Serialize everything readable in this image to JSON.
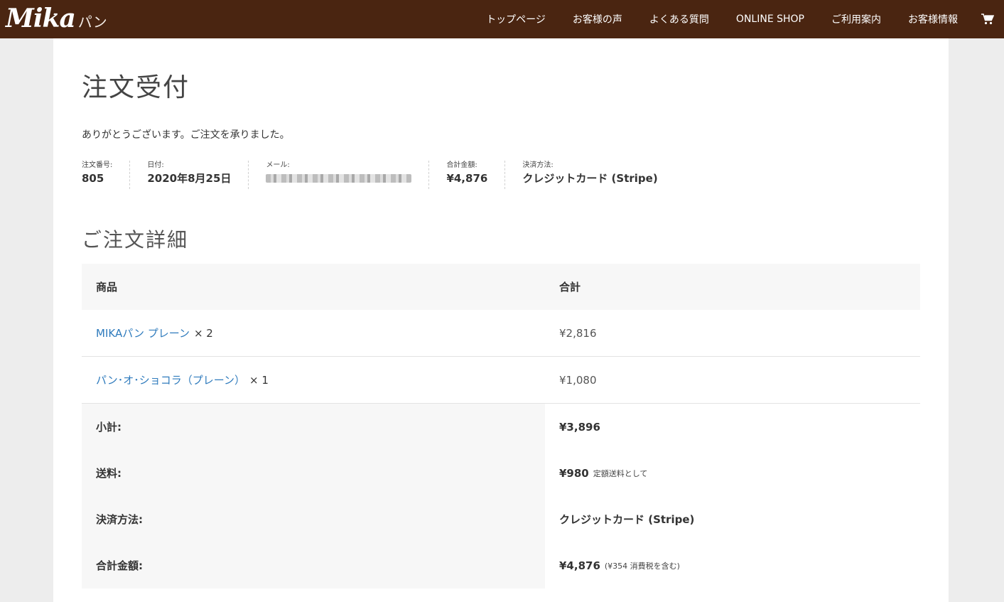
{
  "header": {
    "logo_main": "Mika",
    "logo_sub": "パン",
    "nav": [
      "トップページ",
      "お客様の声",
      "よくある質問",
      "ONLINE SHOP",
      "ご利用案内",
      "お客様情報"
    ]
  },
  "page": {
    "title": "注文受付",
    "thanks": "ありがとうございます。ご注文を承りました。"
  },
  "overview": {
    "order_number": {
      "label": "注文番号:",
      "value": "805"
    },
    "date": {
      "label": "日付:",
      "value": "2020年8月25日"
    },
    "email": {
      "label": "メール:"
    },
    "total": {
      "label": "合計金額:",
      "value": "¥4,876"
    },
    "payment": {
      "label": "決済方法:",
      "value": "クレジットカード (Stripe)"
    }
  },
  "details": {
    "title": "ご注文詳細",
    "headers": {
      "product": "商品",
      "total": "合計"
    },
    "items": [
      {
        "name": "MIKAパン プレーン",
        "qty": "× 2",
        "total": "¥2,816"
      },
      {
        "name": "パン･オ･ショコラ（プレーン）",
        "qty": "× 1",
        "total": "¥1,080"
      }
    ],
    "summary": {
      "subtotal": {
        "label": "小計:",
        "value": "¥3,896"
      },
      "shipping": {
        "label": "送料:",
        "value": "¥980",
        "note": "定額送料として"
      },
      "payment": {
        "label": "決済方法:",
        "value": "クレジットカード (Stripe)"
      },
      "total": {
        "label": "合計金額:",
        "value": "¥4,876",
        "note": "(¥354 消費税を含む)"
      }
    }
  },
  "colors": {
    "header_bg": "#4a2511",
    "link": "#2f7bbd",
    "page_bg": "#ededed"
  }
}
